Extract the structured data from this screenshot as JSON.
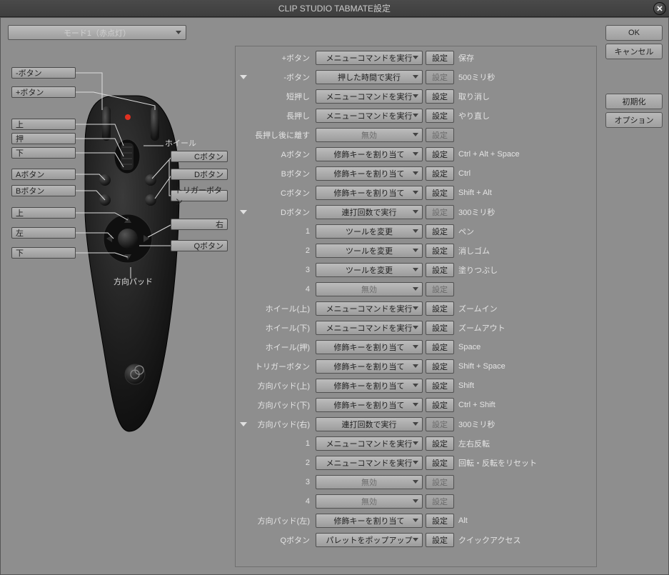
{
  "title": "CLIP STUDIO TABMATE設定",
  "mode_selector": "モード1（赤点灯）",
  "sidebar": {
    "ok": "OK",
    "cancel": "キャンセル",
    "reset": "初期化",
    "option": "オプション"
  },
  "actions": {
    "set": "設定"
  },
  "callouts_left": [
    "-ボタン",
    "+ボタン",
    "上",
    "押",
    "下",
    "Aボタン",
    "Bボタン",
    "上",
    "左",
    "下"
  ],
  "callouts_right": [
    "Cボタン",
    "Dボタン",
    "トリガーボタン",
    "右",
    "Qボタン"
  ],
  "device_labels": {
    "wheel": "ホイール",
    "dpad": "方向パッド"
  },
  "rows": [
    {
      "expand": "",
      "label": "+ボタン",
      "action": "メニューコマンドを実行",
      "set": true,
      "value": "保存"
    },
    {
      "expand": "tri",
      "label": "-ボタン",
      "action": "押した時間で実行",
      "set": false,
      "value": "500ミリ秒"
    },
    {
      "expand": "",
      "label": "短押し",
      "action": "メニューコマンドを実行",
      "set": true,
      "value": "取り消し"
    },
    {
      "expand": "",
      "label": "長押し",
      "action": "メニューコマンドを実行",
      "set": true,
      "value": "やり直し"
    },
    {
      "expand": "",
      "label": "長押し後に離す",
      "action": "無効",
      "action_dis": true,
      "set": false,
      "value": ""
    },
    {
      "expand": "",
      "label": "Aボタン",
      "action": "修飾キーを割り当て",
      "set": true,
      "value": "Ctrl + Alt + Space"
    },
    {
      "expand": "",
      "label": "Bボタン",
      "action": "修飾キーを割り当て",
      "set": true,
      "value": "Ctrl"
    },
    {
      "expand": "",
      "label": "Cボタン",
      "action": "修飾キーを割り当て",
      "set": true,
      "value": "Shift + Alt"
    },
    {
      "expand": "tri",
      "label": "Dボタン",
      "action": "連打回数で実行",
      "set": false,
      "value": "300ミリ秒"
    },
    {
      "expand": "",
      "label": "1",
      "action": "ツールを変更",
      "set": true,
      "value": "ペン"
    },
    {
      "expand": "",
      "label": "2",
      "action": "ツールを変更",
      "set": true,
      "value": "消しゴム"
    },
    {
      "expand": "",
      "label": "3",
      "action": "ツールを変更",
      "set": true,
      "value": "塗りつぶし"
    },
    {
      "expand": "",
      "label": "4",
      "action": "無効",
      "action_dis": true,
      "set": false,
      "value": ""
    },
    {
      "expand": "",
      "label": "ホイール(上)",
      "action": "メニューコマンドを実行",
      "set": true,
      "value": "ズームイン"
    },
    {
      "expand": "",
      "label": "ホイール(下)",
      "action": "メニューコマンドを実行",
      "set": true,
      "value": "ズームアウト"
    },
    {
      "expand": "",
      "label": "ホイール(押)",
      "action": "修飾キーを割り当て",
      "set": true,
      "value": "Space"
    },
    {
      "expand": "",
      "label": "トリガーボタン",
      "action": "修飾キーを割り当て",
      "set": true,
      "value": "Shift + Space"
    },
    {
      "expand": "",
      "label": "方向パッド(上)",
      "action": "修飾キーを割り当て",
      "set": true,
      "value": "Shift"
    },
    {
      "expand": "",
      "label": "方向パッド(下)",
      "action": "修飾キーを割り当て",
      "set": true,
      "value": "Ctrl + Shift"
    },
    {
      "expand": "tri",
      "label": "方向パッド(右)",
      "action": "連打回数で実行",
      "set": false,
      "value": "300ミリ秒"
    },
    {
      "expand": "",
      "label": "1",
      "action": "メニューコマンドを実行",
      "set": true,
      "value": "左右反転"
    },
    {
      "expand": "",
      "label": "2",
      "action": "メニューコマンドを実行",
      "set": true,
      "value": "回転・反転をリセット"
    },
    {
      "expand": "",
      "label": "3",
      "action": "無効",
      "action_dis": true,
      "set": false,
      "value": ""
    },
    {
      "expand": "",
      "label": "4",
      "action": "無効",
      "action_dis": true,
      "set": false,
      "value": ""
    },
    {
      "expand": "",
      "label": "方向パッド(左)",
      "action": "修飾キーを割り当て",
      "set": true,
      "value": "Alt"
    },
    {
      "expand": "",
      "label": "Qボタン",
      "action": "パレットをポップアップ",
      "set": true,
      "value": "クイックアクセス"
    }
  ]
}
